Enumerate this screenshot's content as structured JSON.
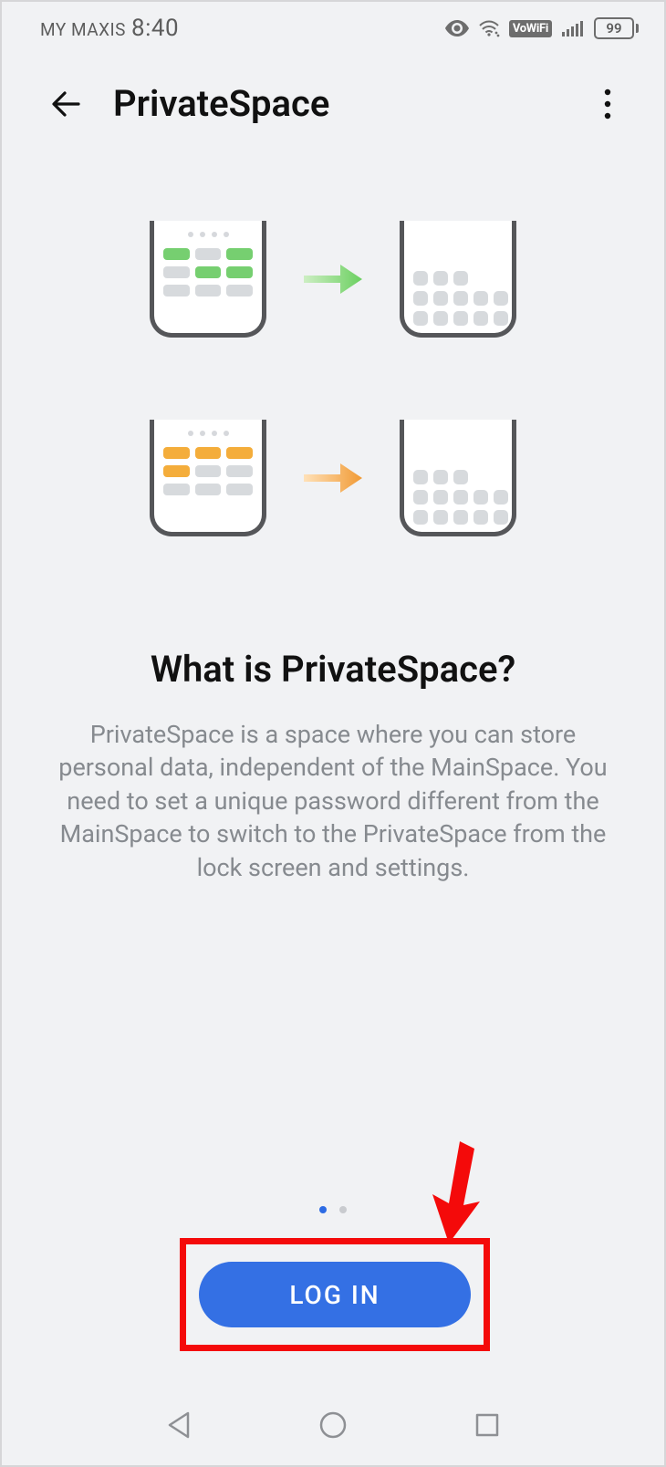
{
  "statusbar": {
    "carrier": "MY MAXIS",
    "time": "8:40",
    "vowifi": "VoWiFi",
    "battery": "99"
  },
  "header": {
    "title": "PrivateSpace"
  },
  "content": {
    "heading": "What is PrivateSpace?",
    "body": "PrivateSpace is a space where you can store personal data, independent of the MainSpace. You need to set a unique password different from the MainSpace to switch to the PrivateSpace from the lock screen and settings."
  },
  "pager": {
    "count": 2,
    "active": 0
  },
  "button": {
    "login": "LOG IN"
  },
  "icons": {
    "eye": "eye-icon",
    "wifi": "wifi-icon",
    "signal": "signal-icon"
  }
}
